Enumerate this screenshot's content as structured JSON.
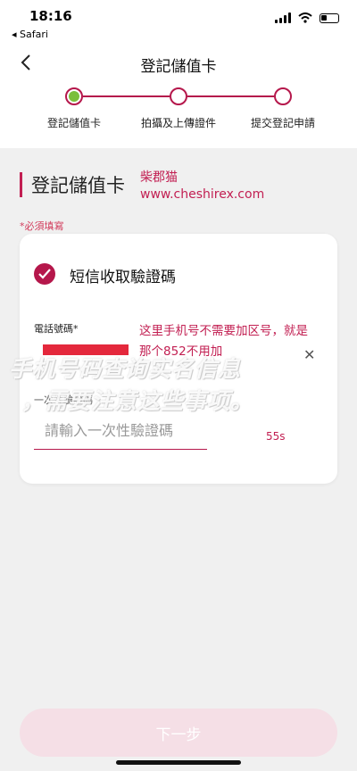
{
  "status_bar": {
    "time": "18:16",
    "back_app": "◂ Safari"
  },
  "nav": {
    "title": "登記儲值卡"
  },
  "steps": [
    {
      "label": "登記儲值卡",
      "active": true
    },
    {
      "label": "拍攝及上傳證件",
      "active": false
    },
    {
      "label": "提交登記申請",
      "active": false
    }
  ],
  "section": {
    "title": "登記儲值卡",
    "required_note": "*必須填寫"
  },
  "brand": {
    "name": "柴郡猫",
    "url": "www.cheshirex.com"
  },
  "card": {
    "title": "短信收取驗證碼",
    "phone_label": "電話號碼*",
    "annotation": "这里手机号不需要加区号，就是那个852不用加",
    "clear_symbol": "✕",
    "otp_label": "一次性驗證碼",
    "otp_placeholder": "請輸入一次性驗證碼",
    "countdown": "55s"
  },
  "watermark": {
    "line1": "手机号码查询实名信息",
    "line2": "，需要注意这些事项。"
  },
  "next_button": {
    "label": "下一步"
  },
  "colors": {
    "accent": "#b5174b",
    "annotation": "#c21f52",
    "step_active": "#7bbf3b",
    "button_disabled": "#f5dfe6"
  }
}
